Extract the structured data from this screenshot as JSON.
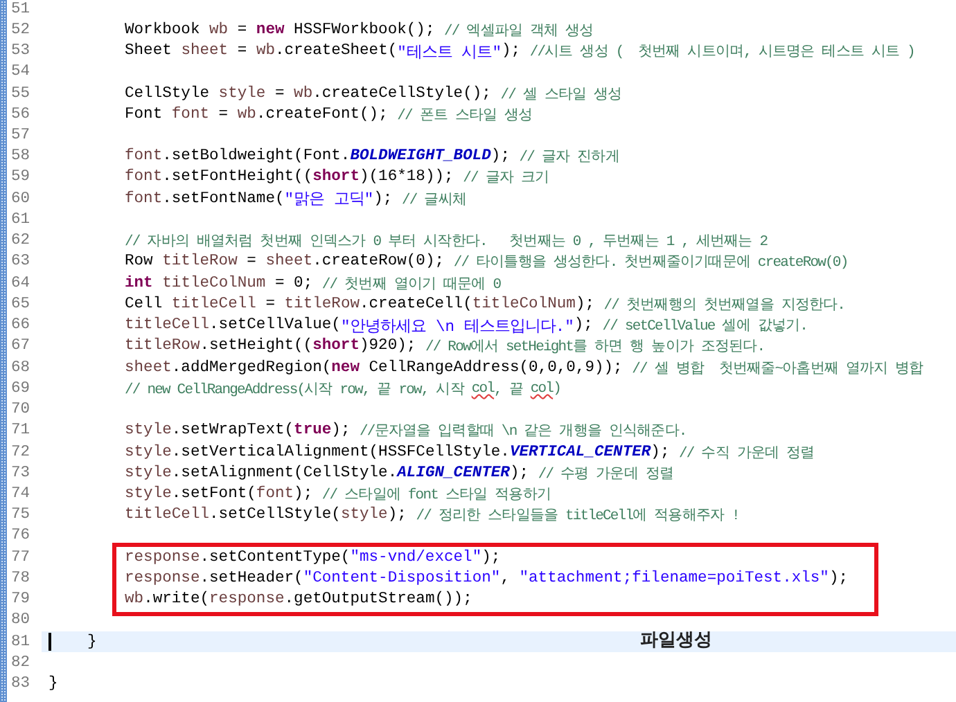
{
  "editor": {
    "sections": [
      {
        "lines": [
          {
            "number": "51",
            "kind": "statement"
          },
          {
            "number": "52",
            "kind": "statement",
            "tokens": [
              {
                "kind": "plain",
                "text": "Workbook "
              },
              {
                "kind": "field",
                "text": "wb"
              },
              {
                "kind": "plain",
                "text": " = "
              },
              {
                "kind": "keyword",
                "text": "new"
              },
              {
                "kind": "plain",
                "text": " HSSFWorkbook(); "
              },
              {
                "kind": "comment",
                "text": "// 엑셀파일 객체 생성"
              }
            ]
          },
          {
            "number": "53",
            "kind": "statement",
            "tokens": [
              {
                "kind": "plain",
                "text": "Sheet "
              },
              {
                "kind": "field",
                "text": "sheet"
              },
              {
                "kind": "plain",
                "text": " = "
              },
              {
                "kind": "field",
                "text": "wb"
              },
              {
                "kind": "plain",
                "text": ".createSheet("
              },
              {
                "kind": "string",
                "text": "\"테스트 시트\""
              },
              {
                "kind": "plain",
                "text": "); "
              },
              {
                "kind": "comment",
                "text": "//시트 생성 (  첫번째 시트이며, 시트명은 테스트 시트 )"
              }
            ]
          },
          {
            "number": "54",
            "kind": "statement"
          },
          {
            "number": "55",
            "kind": "statement",
            "tokens": [
              {
                "kind": "plain",
                "text": "CellStyle "
              },
              {
                "kind": "field",
                "text": "style"
              },
              {
                "kind": "plain",
                "text": " = "
              },
              {
                "kind": "field",
                "text": "wb"
              },
              {
                "kind": "plain",
                "text": ".createCellStyle(); "
              },
              {
                "kind": "comment",
                "text": "// 셀 스타일 생성"
              }
            ]
          },
          {
            "number": "56",
            "kind": "statement",
            "tokens": [
              {
                "kind": "plain",
                "text": "Font "
              },
              {
                "kind": "field",
                "text": "font"
              },
              {
                "kind": "plain",
                "text": " = "
              },
              {
                "kind": "field",
                "text": "wb"
              },
              {
                "kind": "plain",
                "text": ".createFont(); "
              },
              {
                "kind": "comment",
                "text": "// 폰트 스타일 생성"
              }
            ]
          },
          {
            "number": "57",
            "kind": "statement"
          },
          {
            "number": "58",
            "kind": "statement",
            "tokens": [
              {
                "kind": "field",
                "text": "font"
              },
              {
                "kind": "plain",
                "text": ".setBoldweight(Font."
              },
              {
                "kind": "constant",
                "text": "BOLDWEIGHT_BOLD"
              },
              {
                "kind": "plain",
                "text": "); "
              },
              {
                "kind": "comment",
                "text": "// 글자 진하게"
              }
            ]
          },
          {
            "number": "59",
            "kind": "statement",
            "tokens": [
              {
                "kind": "field",
                "text": "font"
              },
              {
                "kind": "plain",
                "text": ".setFontHeight(("
              },
              {
                "kind": "keyword",
                "text": "short"
              },
              {
                "kind": "plain",
                "text": ")(16*18)); "
              },
              {
                "kind": "comment",
                "text": "// 글자 크기"
              }
            ]
          },
          {
            "number": "60",
            "kind": "statement",
            "tokens": [
              {
                "kind": "field",
                "text": "font"
              },
              {
                "kind": "plain",
                "text": ".setFontName("
              },
              {
                "kind": "string",
                "text": "\"맑은 고딕\""
              },
              {
                "kind": "plain",
                "text": "); "
              },
              {
                "kind": "comment",
                "text": "// 글씨체"
              }
            ]
          },
          {
            "number": "61",
            "kind": "statement"
          },
          {
            "number": "62",
            "kind": "statement",
            "tokens": [
              {
                "kind": "comment",
                "text": "// 자바의 배열처럼 첫번째 인덱스가 0 부터 시작한다.   첫번째는 0 , 두번째는 1 , 세번째는 2"
              }
            ]
          },
          {
            "number": "63",
            "kind": "statement",
            "tokens": [
              {
                "kind": "plain",
                "text": "Row "
              },
              {
                "kind": "field",
                "text": "titleRow"
              },
              {
                "kind": "plain",
                "text": " = "
              },
              {
                "kind": "field",
                "text": "sheet"
              },
              {
                "kind": "plain",
                "text": ".createRow(0); "
              },
              {
                "kind": "comment",
                "text": "// 타이틀행을 생성한다. 첫번째줄이기때문에 createRow(0)"
              }
            ]
          },
          {
            "number": "64",
            "kind": "statement",
            "tokens": [
              {
                "kind": "keyword",
                "text": "int"
              },
              {
                "kind": "field",
                "text": "titleColNum"
              },
              {
                "kind": "plain",
                "text": " = 0; "
              },
              {
                "kind": "comment",
                "text": "// 첫번째 열이기 때문에 0"
              }
            ]
          },
          {
            "number": "65",
            "kind": "statement",
            "tokens": [
              {
                "kind": "plain",
                "text": "Cell "
              },
              {
                "kind": "field",
                "text": "titleCell"
              },
              {
                "kind": "plain",
                "text": " = "
              },
              {
                "kind": "field",
                "text": "titleRow"
              },
              {
                "kind": "plain",
                "text": ".createCell("
              },
              {
                "kind": "field",
                "text": "titleColNum"
              },
              {
                "kind": "plain",
                "text": "); "
              },
              {
                "kind": "comment",
                "text": "// 첫번째행의 첫번째열을 지정한다."
              }
            ]
          },
          {
            "number": "66",
            "kind": "statement",
            "tokens": [
              {
                "kind": "field",
                "text": "titleCell"
              },
              {
                "kind": "plain",
                "text": ".setCellValue("
              },
              {
                "kind": "string",
                "text": "\"안녕하세요 \\n 테스트입니다.\""
              },
              {
                "kind": "plain",
                "text": "); "
              },
              {
                "kind": "comment",
                "text": "// setCellValue 셀에 값넣기."
              }
            ]
          },
          {
            "number": "67",
            "kind": "statement",
            "tokens": [
              {
                "kind": "field",
                "text": "titleRow"
              },
              {
                "kind": "plain",
                "text": ".setHeight(("
              },
              {
                "kind": "keyword",
                "text": "short"
              },
              {
                "kind": "plain",
                "text": ")920); "
              },
              {
                "kind": "comment",
                "text": "// Row에서 setHeight를 하면 행 높이가 조정된다."
              }
            ]
          },
          {
            "number": "68",
            "kind": "statement",
            "tokens": [
              {
                "kind": "field",
                "text": "sheet"
              },
              {
                "kind": "plain",
                "text": ".addMergedRegion("
              },
              {
                "kind": "keyword",
                "text": "new"
              },
              {
                "kind": "plain",
                "text": " CellRangeAddress(0,0,0,9)); "
              },
              {
                "kind": "comment",
                "text": "// 셀 병합  첫번째줄~아홉번째 열까지 병합"
              }
            ]
          },
          {
            "number": "69",
            "kind": "statement",
            "tokens": [
              {
                "kind": "comment",
                "text": "// new CellRangeAddress(시작 row, 끝 row, 시작 "
              },
              {
                "kind": "misspelled",
                "text": "col"
              },
              {
                "kind": "comment",
                "text": ", 끝 "
              },
              {
                "kind": "misspelled",
                "text": "col"
              },
              {
                "kind": "comment",
                "text": ")"
              }
            ]
          },
          {
            "number": "70",
            "kind": "statement"
          },
          {
            "number": "71",
            "kind": "statement",
            "tokens": [
              {
                "kind": "field",
                "text": "style"
              },
              {
                "kind": "plain",
                "text": ".setWrapText("
              },
              {
                "kind": "keyword",
                "text": "true"
              },
              {
                "kind": "plain",
                "text": "); "
              },
              {
                "kind": "comment",
                "text": "//문자열을 입력할때 \\n 같은 개행을 인식해준다."
              }
            ]
          },
          {
            "number": "72",
            "kind": "statement",
            "tokens": [
              {
                "kind": "field",
                "text": "style"
              },
              {
                "kind": "plain",
                "text": ".setVerticalAlignment(HSSFCellStyle."
              },
              {
                "kind": "constant",
                "text": "VERTICAL_CENTER"
              },
              {
                "kind": "plain",
                "text": "); "
              },
              {
                "kind": "comment",
                "text": "// 수직 가운데 정렬"
              }
            ]
          },
          {
            "number": "73",
            "kind": "statement",
            "tokens": [
              {
                "kind": "field",
                "text": "style"
              },
              {
                "kind": "plain",
                "text": ".setAlignment(CellStyle."
              },
              {
                "kind": "constant",
                "text": "ALIGN_CENTER"
              },
              {
                "kind": "plain",
                "text": "); "
              },
              {
                "kind": "comment",
                "text": "// 수평 가운데 정렬"
              }
            ]
          },
          {
            "number": "74",
            "kind": "statement",
            "tokens": [
              {
                "kind": "field",
                "text": "style"
              },
              {
                "kind": "plain",
                "text": ".setFont("
              },
              {
                "kind": "field",
                "text": "font"
              },
              {
                "kind": "plain",
                "text": "); "
              },
              {
                "kind": "comment",
                "text": "// 스타일에 font 스타일 적용하기"
              }
            ]
          },
          {
            "number": "75",
            "kind": "statement",
            "tokens": [
              {
                "kind": "field",
                "text": "titleCell"
              },
              {
                "kind": "plain",
                "text": ".setCellStyle("
              },
              {
                "kind": "field",
                "text": "style"
              },
              {
                "kind": "plain",
                "text": "); "
              },
              {
                "kind": "comment",
                "text": "// 정리한 스타일들을 titleCell에 적용해주자 !"
              }
            ]
          },
          {
            "number": "76",
            "kind": "statement"
          }
        ]
      },
      {
        "boxed": true,
        "lines": [
          {
            "number": "77",
            "kind": "statement",
            "tokens": [
              {
                "kind": "field",
                "text": "response"
              },
              {
                "kind": "plain",
                "text": ".setContentType("
              },
              {
                "kind": "string",
                "text": "\"ms-vnd/excel\""
              },
              {
                "kind": "plain",
                "text": ");"
              }
            ]
          },
          {
            "number": "78",
            "kind": "statement",
            "tokens": [
              {
                "kind": "field",
                "text": "response"
              },
              {
                "kind": "plain",
                "text": ".setHeader("
              },
              {
                "kind": "string",
                "text": "\"Content-Disposition\""
              },
              {
                "kind": "plain",
                "text": ", "
              },
              {
                "kind": "string",
                "text": "\"attachment;filename=poiTest.xls\""
              },
              {
                "kind": "plain",
                "text": ");"
              }
            ]
          },
          {
            "number": "79",
            "kind": "statement",
            "tokens": [
              {
                "kind": "field",
                "text": "wb"
              },
              {
                "kind": "plain",
                "text": ".write("
              },
              {
                "kind": "field",
                "text": "response"
              },
              {
                "kind": "plain",
                "text": ".getOutputStream());"
              }
            ]
          },
          {
            "number": "80",
            "kind": "statement"
          }
        ]
      },
      {
        "lines": [
          {
            "number": "81",
            "kind": "method-end",
            "current": true,
            "note": "파일생성",
            "tokens": [
              {
                "kind": "plain",
                "text": "}"
              }
            ]
          },
          {
            "number": "82",
            "kind": "statement"
          },
          {
            "number": "83",
            "kind": "class-end",
            "tokens": [
              {
                "kind": "plain",
                "text": "}"
              }
            ]
          }
        ]
      }
    ]
  }
}
